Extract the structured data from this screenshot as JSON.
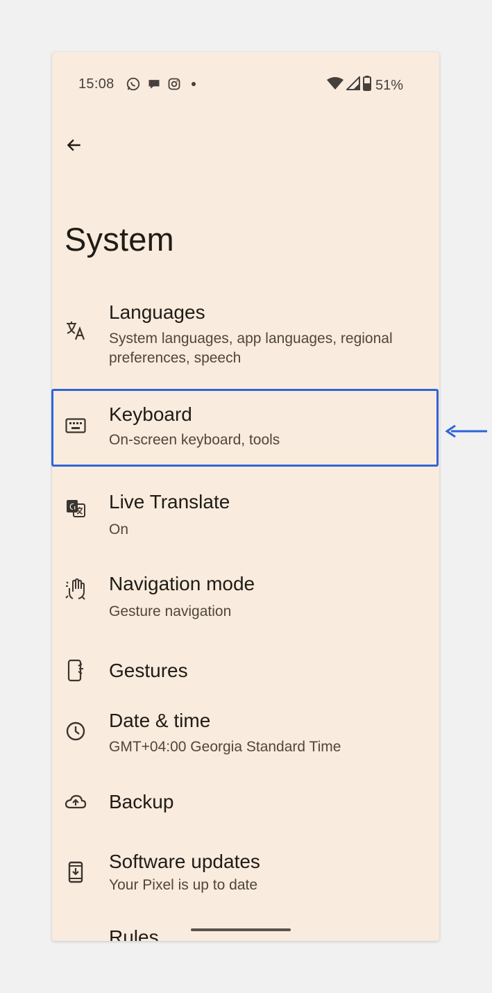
{
  "status_bar": {
    "time": "15:08",
    "battery_percent": "51%",
    "icons_left": [
      "whatsapp-icon",
      "chat-bubble-icon",
      "instagram-icon",
      "notification-dot"
    ],
    "icons_right": [
      "wifi-icon",
      "signal-icon",
      "battery-icon"
    ]
  },
  "header": {
    "back_icon": "arrow-back-icon",
    "title": "System"
  },
  "settings": [
    {
      "icon": "translate-icon",
      "title": "Languages",
      "subtitle": "System languages, app languages, regional preferences, speech"
    },
    {
      "icon": "keyboard-icon",
      "title": "Keyboard",
      "subtitle": "On-screen keyboard, tools",
      "highlighted": true
    },
    {
      "icon": "live-translate-icon",
      "title": "Live Translate",
      "subtitle": "On"
    },
    {
      "icon": "gesture-hand-icon",
      "title": "Navigation mode",
      "subtitle": "Gesture navigation"
    },
    {
      "icon": "phone-gesture-icon",
      "title": "Gestures",
      "subtitle": ""
    },
    {
      "icon": "clock-icon",
      "title": "Date & time",
      "subtitle": "GMT+04:00 Georgia Standard Time"
    },
    {
      "icon": "cloud-upload-icon",
      "title": "Backup",
      "subtitle": ""
    },
    {
      "icon": "system-update-icon",
      "title": "Software updates",
      "subtitle": "Your Pixel is up to date"
    },
    {
      "icon": "",
      "title": "Rules",
      "subtitle": ""
    }
  ],
  "colors": {
    "background": "#f9ebdd",
    "highlight": "#2f64d8",
    "text_primary": "#1f1b16",
    "text_secondary": "#50463c"
  }
}
